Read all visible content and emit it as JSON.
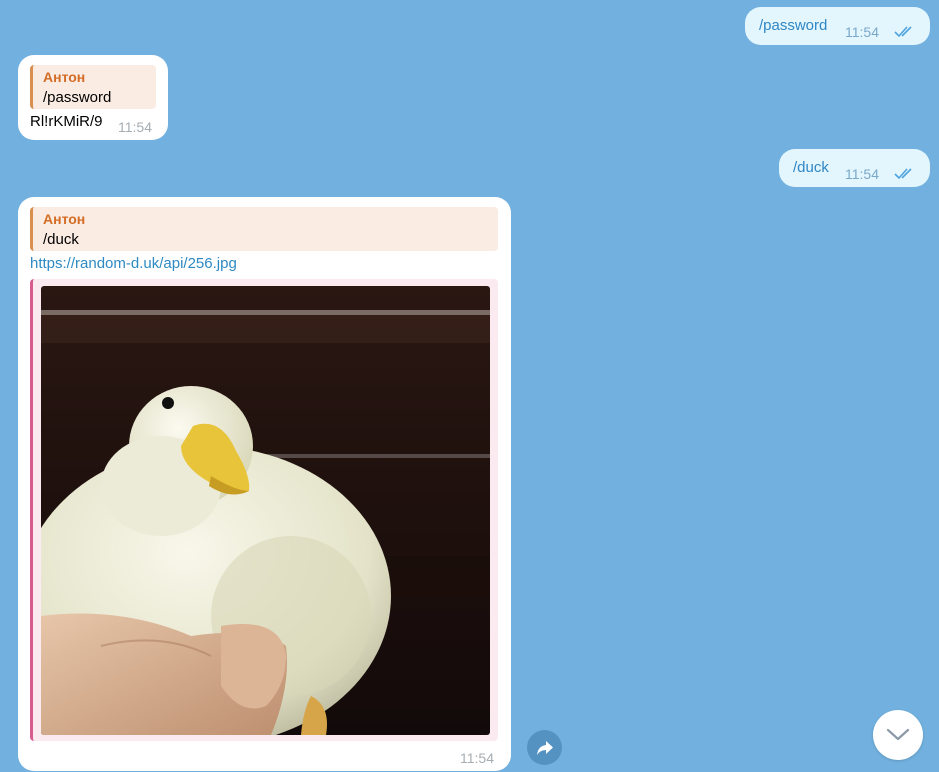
{
  "messages": {
    "out1": {
      "text": "/password",
      "time": "11:54"
    },
    "in1": {
      "reply_author": "Антон",
      "reply_text": "/password",
      "text": "Rl!rKMiR/9",
      "time": "11:54"
    },
    "out2": {
      "text": "/duck",
      "time": "11:54"
    },
    "in2": {
      "reply_author": "Антон",
      "reply_text": "/duck",
      "link": "https://random-d.uk/api/256.jpg",
      "time": "11:54"
    }
  },
  "icons": {
    "read_checks": "double-check-icon",
    "forward": "share-arrow-icon",
    "scroll_down": "chevron-down-icon"
  },
  "colors": {
    "background": "#72b1df",
    "outgoing_bubble": "#e3f6fe",
    "incoming_bubble": "#ffffff",
    "reply_author": "#d36d26",
    "link": "#2d8ac2"
  }
}
